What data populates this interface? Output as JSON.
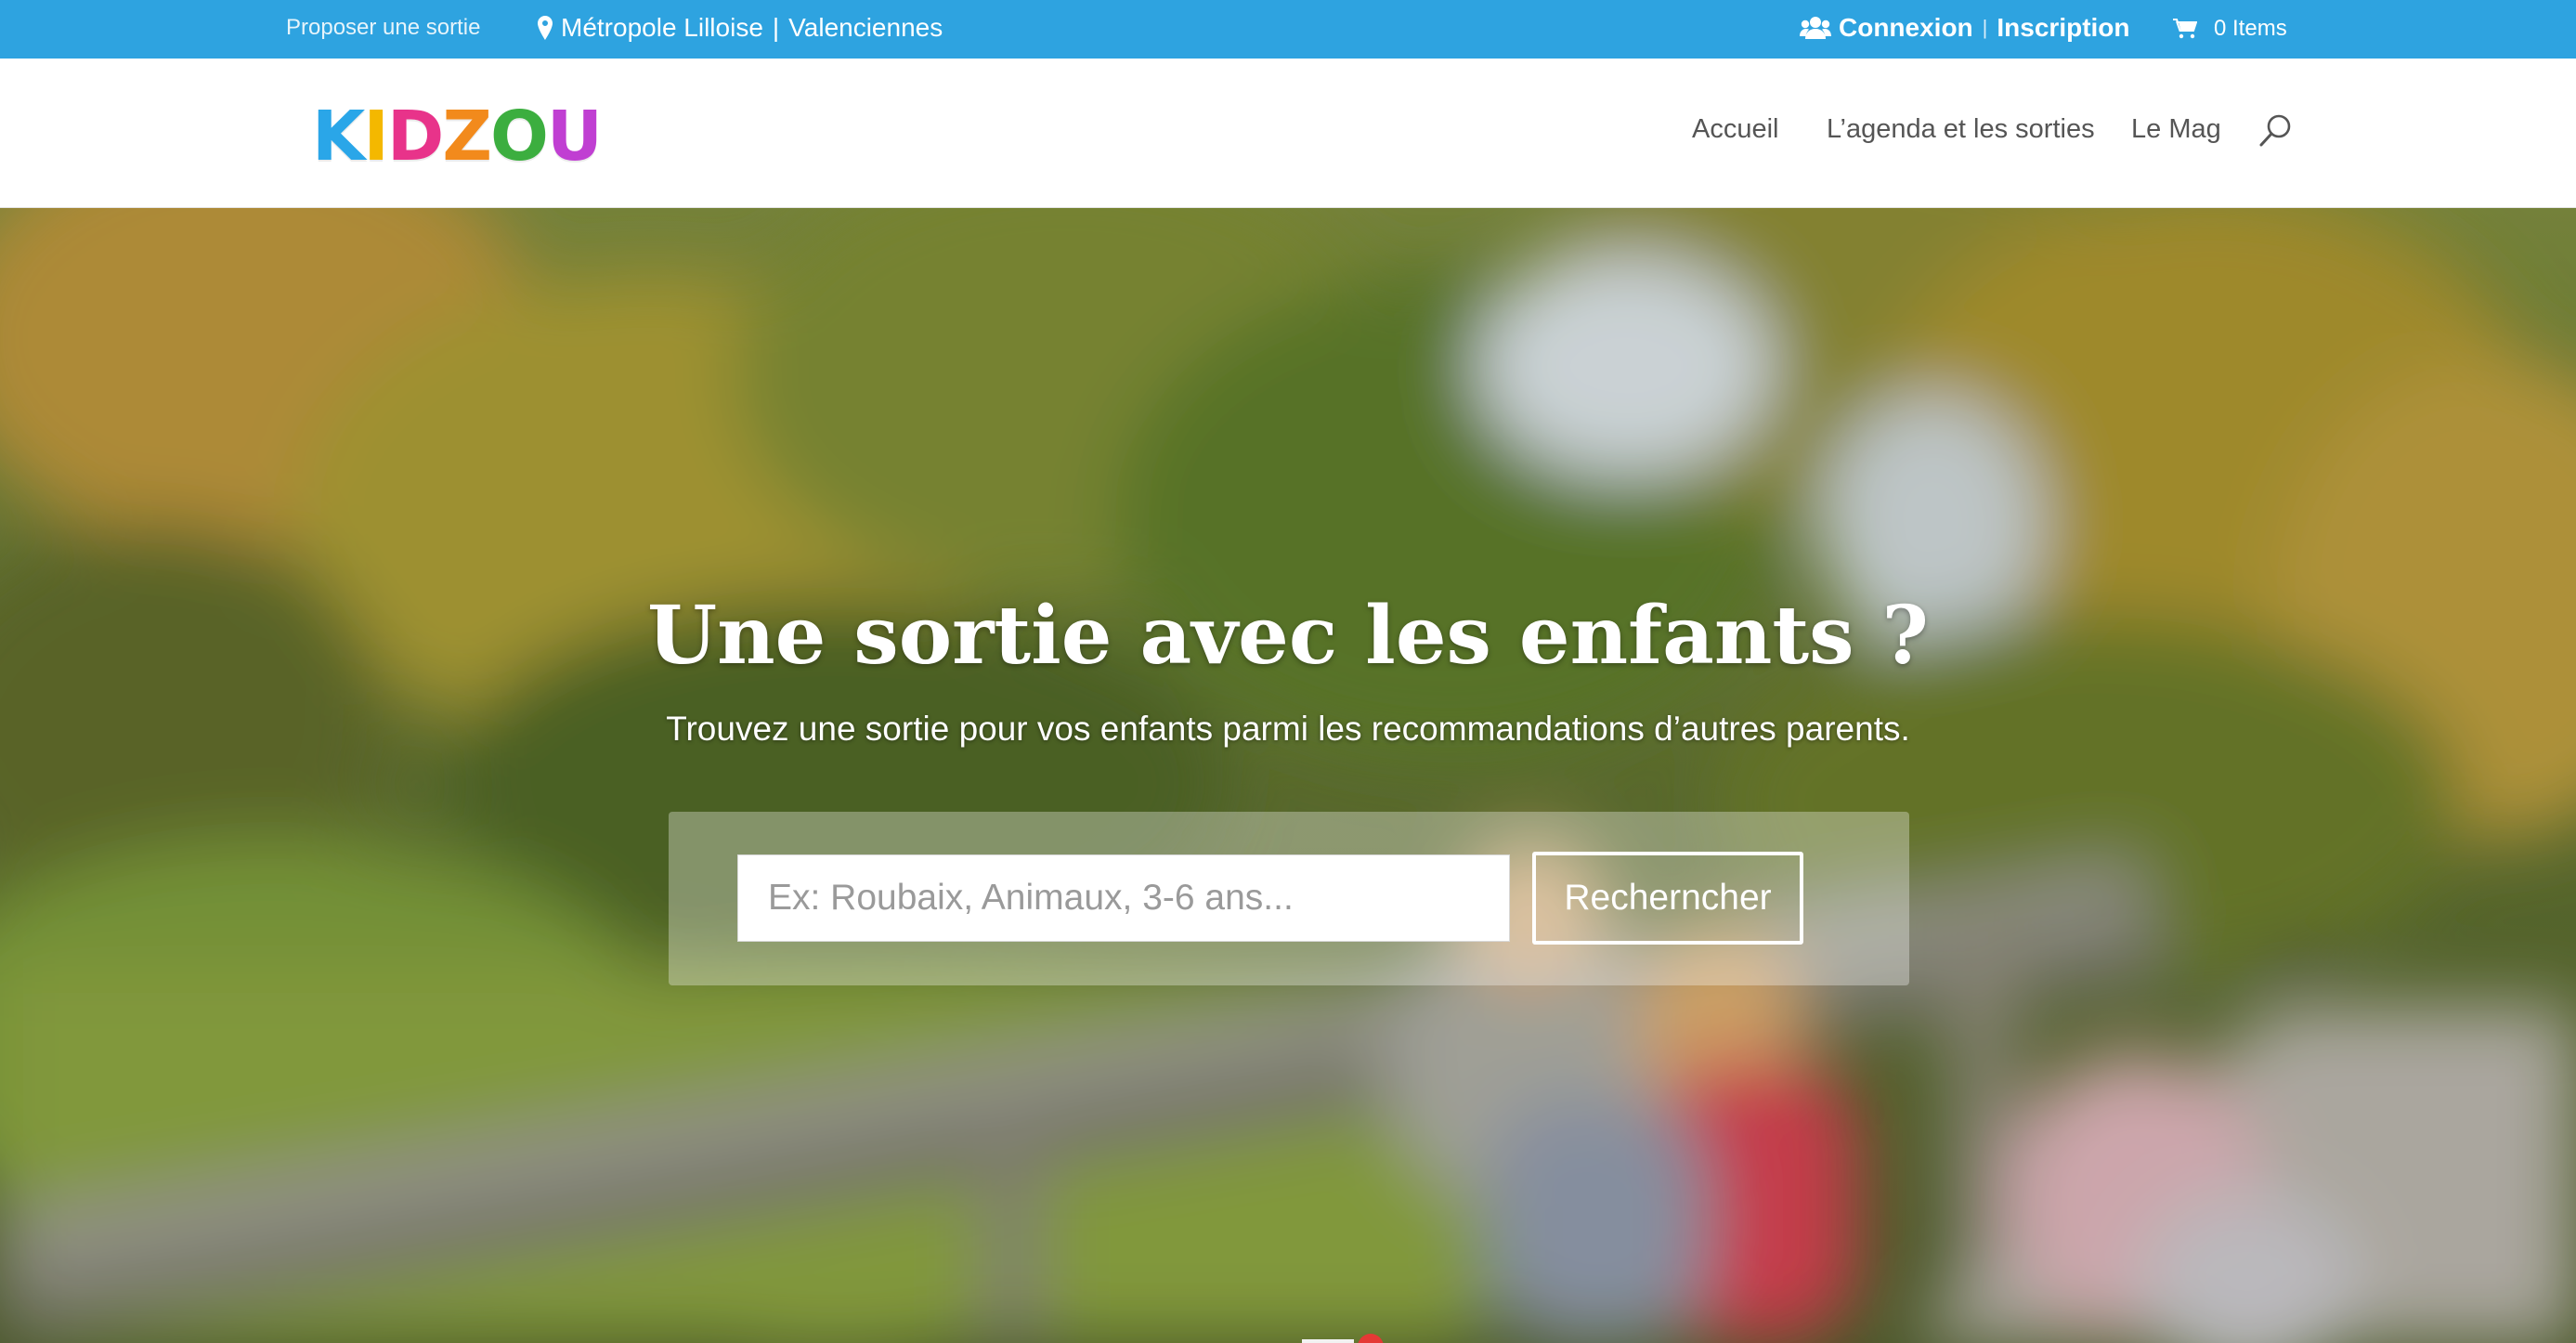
{
  "topbar": {
    "propose_label": "Proposer une sortie",
    "location_metro": "Métropole Lilloise",
    "location_separator": "|",
    "location_valenciennes": "Valenciennes",
    "login_label": "Connexion",
    "auth_separator": "|",
    "register_label": "Inscription",
    "cart_label": "0 Items",
    "background_color": "#2ea3e0"
  },
  "logo": {
    "text": "KIDZOU",
    "letters": [
      {
        "char": "K",
        "color": "#2aa6e8"
      },
      {
        "char": "I",
        "color": "#f4b800"
      },
      {
        "char": "D",
        "color": "#e8338a"
      },
      {
        "char": "Z",
        "color": "#f28a1c"
      },
      {
        "char": "O",
        "color": "#3cae3f"
      },
      {
        "char": "U",
        "color": "#c03fd2"
      }
    ]
  },
  "nav": {
    "items": [
      {
        "label": "Accueil"
      },
      {
        "label": "L’agenda et les sorties"
      },
      {
        "label": "Le Mag"
      }
    ],
    "search_icon": "search-icon"
  },
  "hero": {
    "title": "Une sortie avec les enfants ?",
    "subtitle": "Trouvez une sortie pour vos enfants parmi les recommandations d’autres parents.",
    "search_placeholder": "Ex: Roubaix, Animaux, 3-6 ans...",
    "search_value": "",
    "search_button": "Recherncher"
  }
}
